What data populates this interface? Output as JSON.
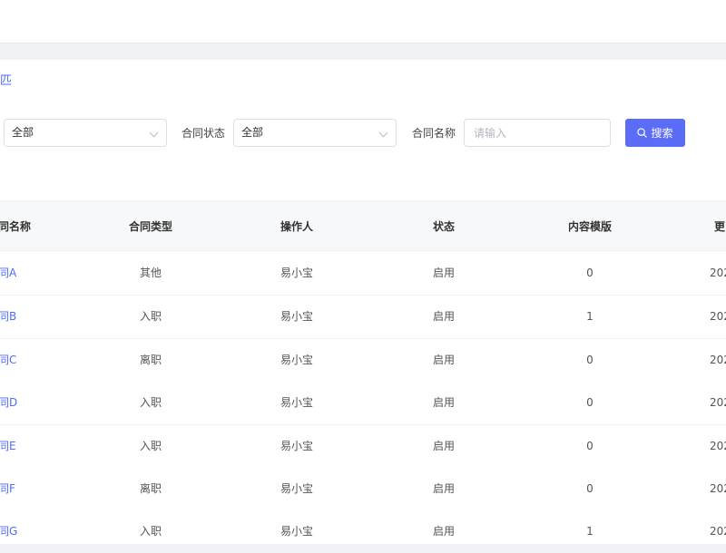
{
  "breadcrumb": {
    "tail": "匹"
  },
  "filters": {
    "type_select_value": "全部",
    "status_label": "合同状态",
    "status_select_value": "全部",
    "name_label": "合同名称",
    "name_placeholder": "请输入",
    "search_button": "搜索"
  },
  "table": {
    "headers": {
      "name": "同名称",
      "type": "合同类型",
      "operator": "操作人",
      "status": "状态",
      "template": "内容模版",
      "updated": "更"
    },
    "rows": [
      {
        "name": "合同A",
        "type": "其他",
        "operator": "易小宝",
        "status": "启用",
        "template": "0",
        "updated": "202"
      },
      {
        "name": "合同B",
        "type": "入职",
        "operator": "易小宝",
        "status": "启用",
        "template": "1",
        "updated": "202"
      },
      {
        "name": "合同C",
        "type": "离职",
        "operator": "易小宝",
        "status": "启用",
        "template": "0",
        "updated": "202"
      },
      {
        "name": "合同D",
        "type": "入职",
        "operator": "易小宝",
        "status": "启用",
        "template": "0",
        "updated": "202"
      },
      {
        "name": "合同E",
        "type": "入职",
        "operator": "易小宝",
        "status": "启用",
        "template": "0",
        "updated": "202"
      },
      {
        "name": "合同F",
        "type": "离职",
        "operator": "易小宝",
        "status": "启用",
        "template": "0",
        "updated": "202"
      },
      {
        "name": "合同G",
        "type": "入职",
        "operator": "易小宝",
        "status": "启用",
        "template": "1",
        "updated": "202"
      }
    ]
  },
  "colors": {
    "primary": "#5b6cf6",
    "link": "#4d6bfe",
    "header_bg": "#f7f8fa"
  }
}
